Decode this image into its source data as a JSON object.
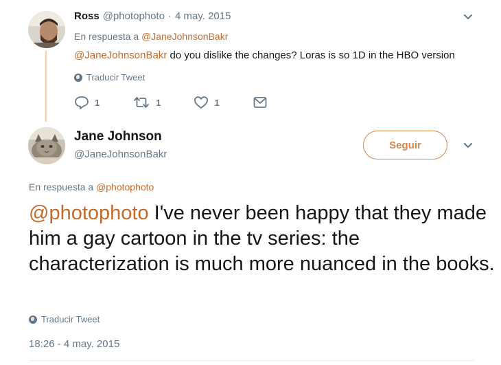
{
  "parent_tweet": {
    "display_name": "Ross",
    "handle": "@photophoto",
    "separator": "·",
    "date": "4 may. 2015",
    "reply_prefix": "En respuesta a",
    "reply_to": "@JaneJohnsonBakr",
    "mention": "@JaneJohnsonBakr",
    "text": " do you dislike the changes? Loras is so 1D in the HBO version",
    "translate_label": "Traducir Tweet",
    "replies_count": "1",
    "retweets_count": "1",
    "likes_count": "1"
  },
  "main_tweet": {
    "display_name": "Jane Johnson",
    "handle": "@JaneJohnsonBakr",
    "follow_label": "Seguir",
    "reply_prefix": "En respuesta a",
    "reply_to": "@photophoto",
    "mention": "@photophoto",
    "text": " I've never been happy that they made him a gay cartoon in the tv series: the characterization is much more nuanced in the books.",
    "translate_label": "Traducir Tweet",
    "timestamp": "18:26 - 4 may. 2015"
  },
  "colors": {
    "accent": "#c46a2b",
    "follow_border": "#d2884f",
    "secondary_text": "#657786",
    "primary_text": "#14171a",
    "thread_line": "#ffd0a8"
  },
  "icons": [
    "reply-icon",
    "retweet-icon",
    "like-icon",
    "direct-message-icon",
    "chevron-down-icon",
    "globe-icon"
  ]
}
